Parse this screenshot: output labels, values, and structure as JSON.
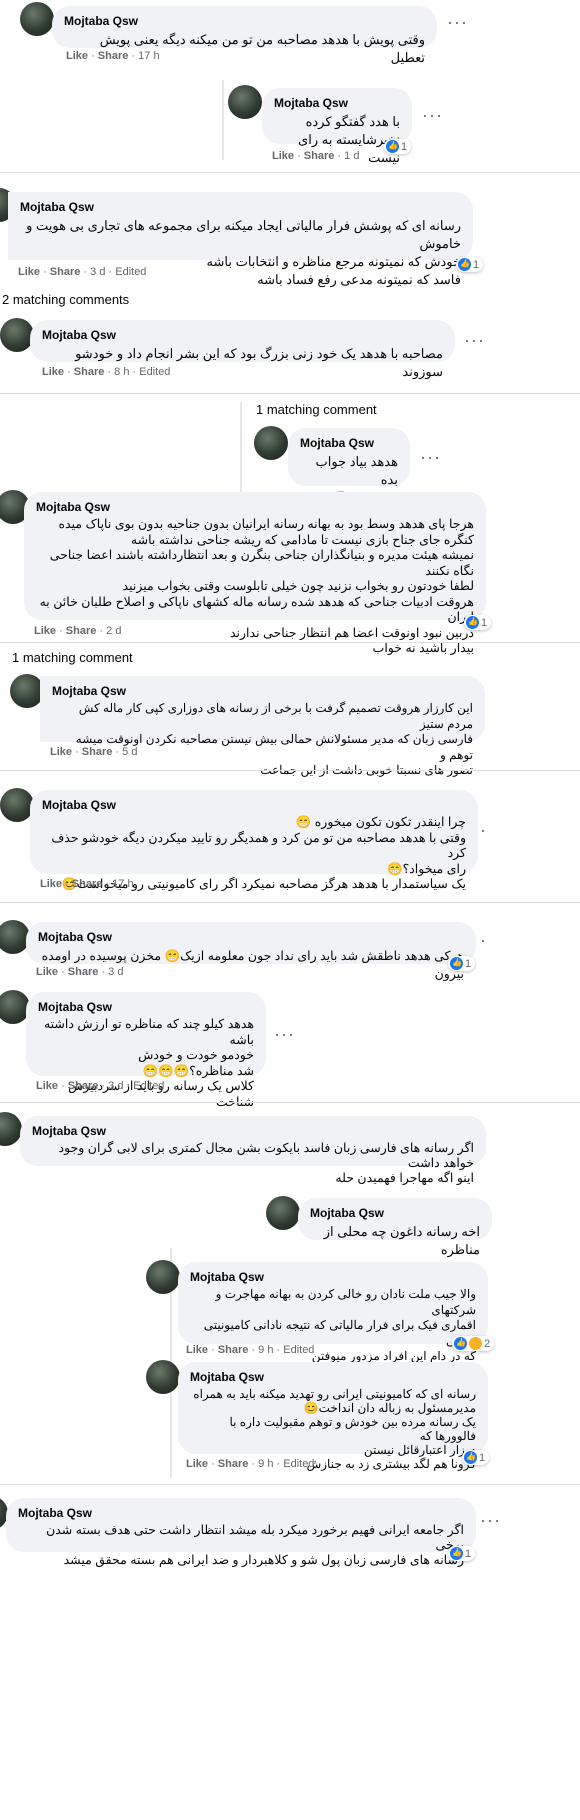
{
  "actions": {
    "like": "Like",
    "share": "Share",
    "sep": " · ",
    "edited": "Edited"
  },
  "comments": [
    {
      "name": "Mojtaba Qsw",
      "text": "وقتی پویش با هدهد مصاحبه من تو من میکنه دیگه یعنی پویش تعطیل",
      "time": "17 h"
    },
    {
      "name": "Mojtaba Qsw",
      "text": "با هدد گفتگو کرده\nنخیرشایسته به رای نیست",
      "time": "1 d",
      "reactions": "1"
    },
    {
      "name": "Mojtaba Qsw",
      "text": "رسانه ای که پوشش فرار مالیاتی ایجاد میکنه برای مجموعه های تجاری بی هویت و خاموش\nخودش که نمیتونه مرجع مناظره و انتخابات باشه\nفاسد که نمیتونه مدعی رفع فساد باشه",
      "time": "3 d",
      "edited": true,
      "reactions": "1"
    },
    {
      "name": "Mojtaba Qsw",
      "text": "مصاحبه با هدهد یک خود زنی بزرگ بود که این بشر انجام داد و خودشو سوزوند",
      "time": "8 h",
      "edited": true
    },
    {
      "name": "Mojtaba Qsw",
      "text": "هدهد بیاد جواب بده\nشاسکول😁"
    },
    {
      "name": "Mojtaba Qsw",
      "text": "هرجا پای هدهد وسط بود به بهانه رسانه ایرانیان بدون جناحیه بدون بوی ناپاک میده\nکنگره جای جناح بازی نیست تا مادامی که ریشه جناحی نداشته باشه\nنمیشه هیئت مدیره و بنیانگذاران جناحی بنگرن و بعد انتظارداشته باشند اعضا جناحی نگاه نکنند\nلطفا خودتون رو بخواب نزنید چون خیلی تابلوست وقتی بخواب میزنید\nهروقت ادبیات جناحی که هدهد شده رسانه ماله کشهای ناپاکی و اصلاح طلبان خائن به ایران\nدربین نبود اونوقت اعضا هم انتظار جناحی ندارند\nبیدار باشید نه خواب",
      "time": "2 d",
      "reactions": "1"
    },
    {
      "name": "Mojtaba Qsw",
      "text": "این کارزار هروقت تصمیم گرفت با برخی از رسانه های دوزاری کپی کار ماله کش مردم ستیز\nفارسی زبان که مدیر مسئولانش حمالی بیش نیستن مصاحبه نکردن اونوقت میشه توهم و\nتصور های نسبتا خوبی داشت از این جماعت",
      "time": "5 d"
    },
    {
      "name": "Mojtaba Qsw",
      "text": "چرا اینقدر تکون تکون میخوره 😁\nوقتی با هدهد مصاحبه من تو من کرد و همدیگر رو تایید میکردن دیگه خودشو حذف کرد\nرای میخواد؟😁\nیک سیاستمدار با هدهد هرگز مصاحبه نمیکرد اگر رای کامیونیتی رو میخواست😊",
      "time": "17 h"
    },
    {
      "name": "Mojtaba Qsw",
      "text": "هرکی هدهد ناطقش شد باید رای نداد جون معلومه ازیک😁 مخزن پوسیده در اومده بیرون",
      "time": "3 d",
      "reactions": "1"
    },
    {
      "name": "Mojtaba Qsw",
      "text": "هدهد کیلو چند که مناظره تو ارزش داشته باشه\nخودمو خودت و خودش\nشد مناظره؟😁😁😁\nکلاس یک رسانه رو باید از سردبیرش شناخت",
      "time": "3 d",
      "edited": true
    },
    {
      "name": "Mojtaba Qsw",
      "text": "اگر رسانه های فارسی زبان فاسد بایکوت بشن مجال کمتری برای لابی گران وجود خواهد داشت\nاینو اگه مهاجرا فهمیدن حله"
    },
    {
      "name": "Mojtaba Qsw",
      "text": "اخه رسانه داغون چه محلی از مناظره"
    },
    {
      "name": "Mojtaba Qsw",
      "text": "والا جیب ملت نادان رو خالی کردن به بهانه مهاجرت و شرکتهای\nاقماری فیک برای فرار مالیاتی که نتیجه نادانی کامیونیتی ایرانی\nکه در دام این افراد مزدور میوفتن\n😁",
      "time": "9 h",
      "edited": true,
      "reactions": "2"
    },
    {
      "name": "Mojtaba Qsw",
      "text": "رسانه ای که کامیونیتی ایرانی رو تهدید میکنه باید به همراه\nمدیرمسئول به زباله دان انداخت😊\nیک رسانه مرده بین خودش و توهم مقبولیت داره با فالوورها که\nدوزار اعتبارقائل نیستن\nکرونا هم لگد بیشتری زد به جنازش",
      "time": "9 h",
      "edited": true,
      "reactions": "1"
    },
    {
      "name": "Mojtaba Qsw",
      "text": "اگر جامعه ایرانی فهیم برخورد میکرد بله میشد انتظار داشت حتی هدف بسته شدن برخی\nرسانه های فارسی زبان پول شو و کلاهبردار و ضد ایرانی هم بسته محقق میشد",
      "reactions": "1"
    }
  ],
  "matching": {
    "two": "2 matching comments",
    "one": "1 matching comment"
  }
}
